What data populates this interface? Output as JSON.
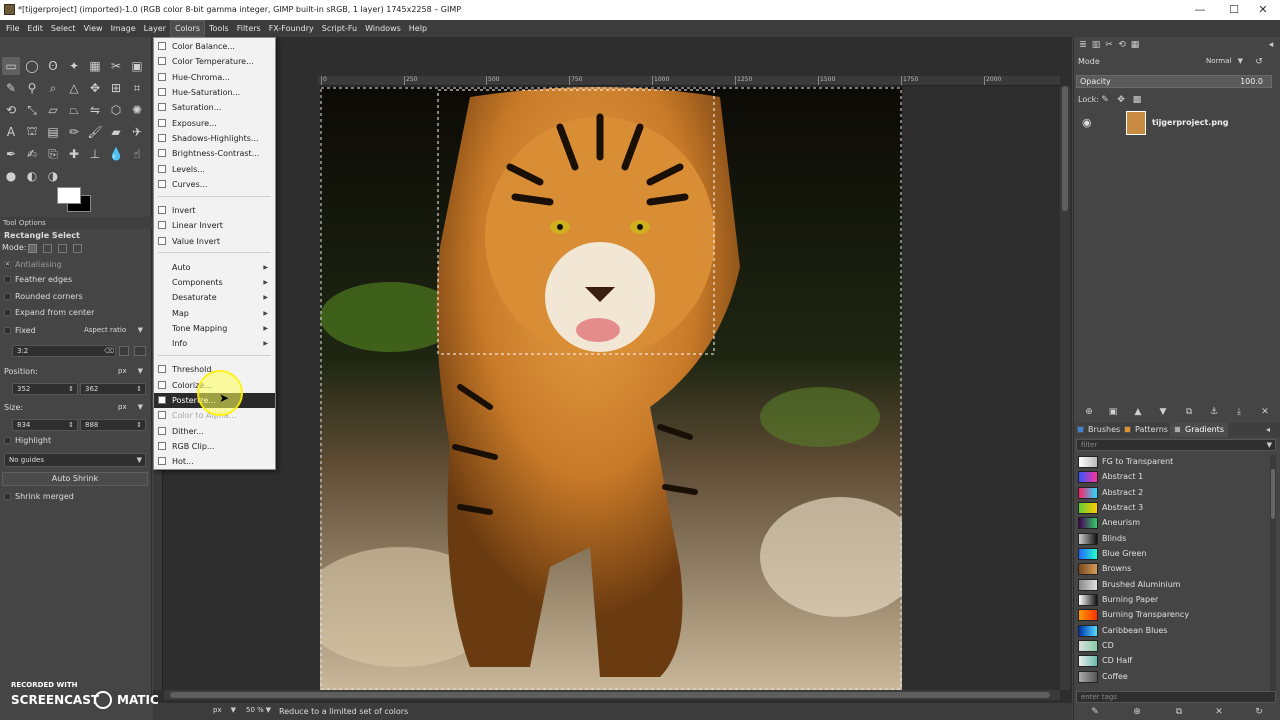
{
  "window": {
    "title": "*[tijgerproject] (imported)-1.0 (RGB color 8-bit gamma integer, GIMP built-in sRGB, 1 layer) 1745x2258 – GIMP",
    "minimize": "—",
    "maximize": "☐",
    "close": "✕"
  },
  "menubar": [
    "File",
    "Edit",
    "Select",
    "View",
    "Image",
    "Layer",
    "Colors",
    "Tools",
    "Filters",
    "FX-Foundry",
    "Script-Fu",
    "Windows",
    "Help"
  ],
  "colors_menu": {
    "group1": [
      "Color Balance...",
      "Color Temperature...",
      "Hue-Chroma...",
      "Hue-Saturation...",
      "Saturation...",
      "Exposure...",
      "Shadows-Highlights...",
      "Brightness-Contrast...",
      "Levels...",
      "Curves..."
    ],
    "group2": [
      "Invert",
      "Linear Invert",
      "Value Invert"
    ],
    "group3": [
      "Auto",
      "Components",
      "Desaturate",
      "Map",
      "Tone Mapping",
      "Info"
    ],
    "group4": [
      "Threshold...",
      "Colorize...",
      "Posterize...",
      "Color to Alpha...",
      "Dither...",
      "RGB Clip...",
      "Hot..."
    ],
    "highlighted": "Posterize...",
    "disabled": "Color to Alpha..."
  },
  "tool_options": {
    "header": "Tool Options",
    "tool_name": "Rectangle Select",
    "mode_label": "Mode:",
    "antialiasing": "Antialiasing",
    "feather_edges": "Feather edges",
    "rounded_corners": "Rounded corners",
    "expand_from_center": "Expand from center",
    "fixed_label": "Fixed",
    "fixed_value": "Aspect ratio",
    "ratio_value": "3:2",
    "position_label": "Position:",
    "position_unit": "px",
    "position_x": "352",
    "position_y": "362",
    "size_label": "Size:",
    "size_unit": "px",
    "size_w": "834",
    "size_h": "888",
    "highlight": "Highlight",
    "guides": "No guides",
    "auto_shrink": "Auto Shrink",
    "shrink_merged": "Shrink merged"
  },
  "ruler_ticks": [
    "0",
    "250",
    "500",
    "750",
    "1000",
    "1250",
    "1500",
    "1750",
    "2000"
  ],
  "statusbar": {
    "unit": "px",
    "zoom": "50 %",
    "message": "Reduce to a limited set of colors"
  },
  "layers": {
    "mode_label": "Mode",
    "mode_value": "Normal",
    "opacity_label": "Opacity",
    "opacity_value": "100.0",
    "lock_label": "Lock:",
    "layer_name": "tijgerproject.png"
  },
  "resources": {
    "tabs": [
      "Brushes",
      "Patterns",
      "Gradients"
    ],
    "filter_placeholder": "filter",
    "tags_placeholder": "enter tags",
    "gradients": [
      {
        "name": "FG to Transparent",
        "c1": "#ffffff",
        "c2": "#bbbbbb"
      },
      {
        "name": "Abstract 1",
        "c1": "#3355ff",
        "c2": "#ff3399"
      },
      {
        "name": "Abstract 2",
        "c1": "#ff2266",
        "c2": "#22ddff"
      },
      {
        "name": "Abstract 3",
        "c1": "#66cc33",
        "c2": "#ffcc00"
      },
      {
        "name": "Aneurism",
        "c1": "#440055",
        "c2": "#33cc66"
      },
      {
        "name": "Blinds",
        "c1": "#cccccc",
        "c2": "#111111"
      },
      {
        "name": "Blue Green",
        "c1": "#2266ff",
        "c2": "#22ffcc"
      },
      {
        "name": "Browns",
        "c1": "#7a4a1f",
        "c2": "#d89a5a"
      },
      {
        "name": "Brushed Aluminium",
        "c1": "#8a8a8a",
        "c2": "#e0e0e0"
      },
      {
        "name": "Burning Paper",
        "c1": "#ffffff",
        "c2": "#111111"
      },
      {
        "name": "Burning Transparency",
        "c1": "#ff9900",
        "c2": "#ff3300"
      },
      {
        "name": "Caribbean Blues",
        "c1": "#0033aa",
        "c2": "#55ddff"
      },
      {
        "name": "CD",
        "c1": "#dddddd",
        "c2": "#88ccaa"
      },
      {
        "name": "CD Half",
        "c1": "#eeeeee",
        "c2": "#66bbaa"
      },
      {
        "name": "Coffee",
        "c1": "#aaaaaa",
        "c2": "#555555"
      }
    ]
  },
  "watermark": {
    "line1": "RECORDED WITH",
    "line2": "SCREENCAST",
    "line3": "MATIC"
  }
}
